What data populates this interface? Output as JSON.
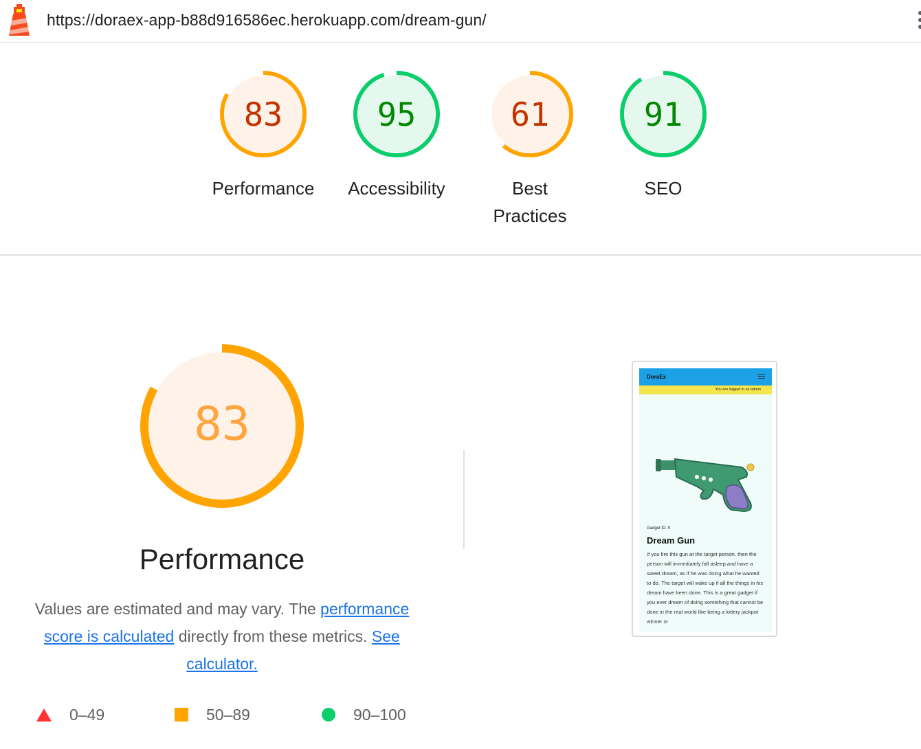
{
  "header": {
    "url": "https://doraex-app-b88d916586ec.herokuapp.com/dream-gun/",
    "logo_icon": "lighthouse-icon",
    "menu_icon": "kebab-menu-icon"
  },
  "gauges": [
    {
      "score": 83,
      "label": "Performance",
      "rating": "average"
    },
    {
      "score": 95,
      "label": "Accessibility",
      "rating": "pass"
    },
    {
      "score": 61,
      "label": "Best Practices",
      "rating": "average"
    },
    {
      "score": 91,
      "label": "SEO",
      "rating": "pass"
    }
  ],
  "performance": {
    "score": 83,
    "title": "Performance",
    "desc_prefix": "Values are estimated and may vary. The ",
    "desc_link1": "performance score is calculated",
    "desc_middle": " directly from these metrics. ",
    "desc_link2": "See calculator."
  },
  "legend": [
    {
      "range": "0–49",
      "shape": "triangle",
      "color": "#ff3333"
    },
    {
      "range": "50–89",
      "shape": "square",
      "color": "#ffa400"
    },
    {
      "range": "90–100",
      "shape": "circle",
      "color": "#0cce6b"
    }
  ],
  "colors": {
    "average_arc": "#ffa400",
    "average_bg": "#fff3e9",
    "average_text": "#c33300",
    "pass_arc": "#0cce6b",
    "pass_bg": "#e5f8ee",
    "pass_text": "#008800",
    "big_text": "#ffa53f"
  },
  "screenshot": {
    "brand": "DoraEx",
    "admin_text": "You are logged in as admin",
    "gadget_id": "Gadget ID: 9",
    "gadget_name": "Dream Gun",
    "gadget_desc": "If you fire this gun at the target person, then the person will immediately fall asleep and have a sweet dream, as if he was doing what he wanted to do. The target will wake up if all the things in his dream have been done. This is a great gadget if you ever dream of doing something that cannot be done in the real world like being a lottery jackpot winner or"
  }
}
